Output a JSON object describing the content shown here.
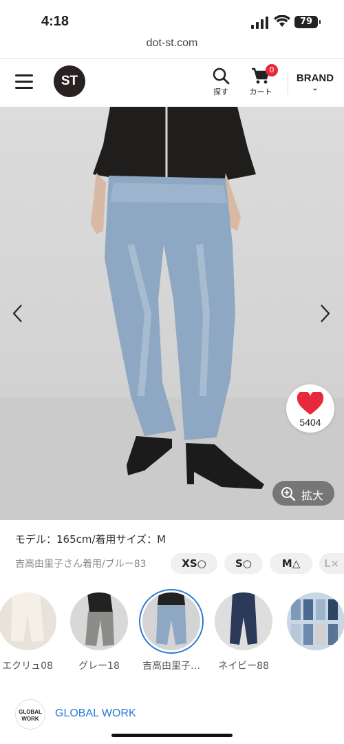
{
  "status_bar": {
    "time": "4:18",
    "battery": "79"
  },
  "url": "dot-st.com",
  "header": {
    "logo": "ST",
    "search_label": "探す",
    "cart_label": "カート",
    "cart_count": "0",
    "brand_label": "BRAND"
  },
  "product": {
    "like_count": "5404",
    "zoom_label": "拡大",
    "model_info": "モデル：165cm/着用サイズ：M",
    "wearing_note": "吉高由里子さん着用/ブルー83",
    "sizes": [
      {
        "label": "XS○"
      },
      {
        "label": "S○"
      },
      {
        "label": "M△"
      },
      {
        "label": "L×"
      }
    ],
    "colors": [
      {
        "label": "エクリュ08"
      },
      {
        "label": "グレー18"
      },
      {
        "label": "吉高由里子…"
      },
      {
        "label": "ネイビー88"
      },
      {
        "label": ""
      }
    ]
  },
  "brand": {
    "logo_text": "GLOBAL WORK",
    "name": "GLOBAL WORK"
  },
  "colors": {
    "accent": "#2a7bd8",
    "badge": "#e8283b",
    "heart": "#e8283b"
  }
}
